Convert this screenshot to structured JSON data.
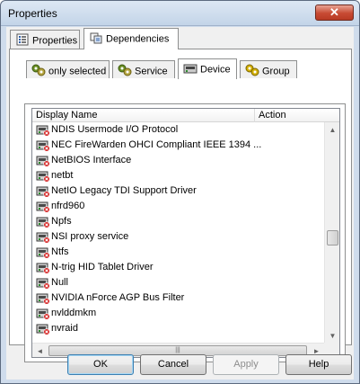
{
  "window": {
    "title": "Properties",
    "close_glyph": "✕"
  },
  "tabs": [
    {
      "label": "Properties",
      "icon": "properties-icon",
      "active": false
    },
    {
      "label": "Dependencies",
      "icon": "dependencies-icon",
      "active": true
    }
  ],
  "subtabs": [
    {
      "label": "only selected",
      "icon": "gears-icon",
      "active": false
    },
    {
      "label": "Service",
      "icon": "gears-icon",
      "active": false
    },
    {
      "label": "Device",
      "icon": "device-icon",
      "active": true
    },
    {
      "label": "Group",
      "icon": "group-icon",
      "active": false
    }
  ],
  "list": {
    "columns": [
      "Display Name",
      "Action"
    ],
    "rows": [
      "NDIS Usermode I/O Protocol",
      "NEC FireWarden OHCI Compliant IEEE 1394 ...",
      "NetBIOS Interface",
      "netbt",
      "NetIO Legacy TDI Support Driver",
      "nfrd960",
      "Npfs",
      "NSI proxy service",
      "Ntfs",
      "N-trig HID Tablet Driver",
      "Null",
      "NVIDIA nForce AGP Bus Filter",
      "nvlddmkm",
      "nvraid"
    ],
    "scroll": {
      "up": "▲",
      "down": "▼",
      "left": "◄",
      "right": "►",
      "grip": "|||"
    }
  },
  "buttons": {
    "ok": "OK",
    "cancel": "Cancel",
    "apply": "Apply",
    "help": "Help"
  },
  "colors": {
    "accent": "#3c7fb1",
    "titlebar": "#c3d4e8",
    "close": "#c74a33"
  }
}
